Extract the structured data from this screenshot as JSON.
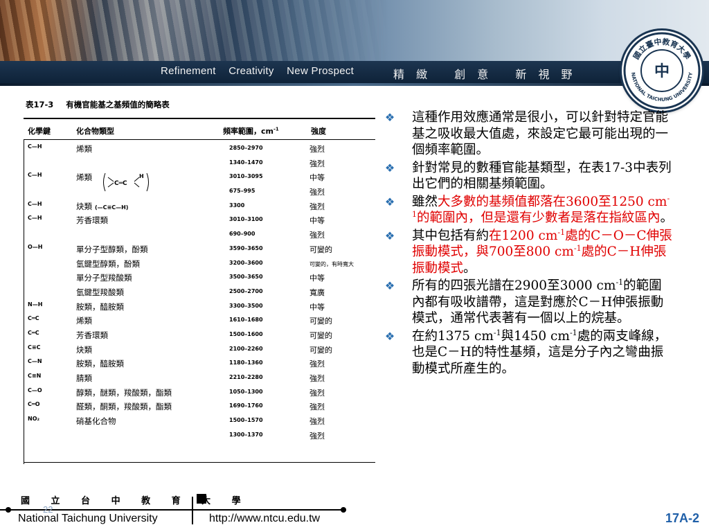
{
  "header": {
    "slogan_en": [
      "Refinement",
      "Creativity",
      "New Prospect"
    ],
    "slogan_cn": [
      "精 緻",
      "創 意",
      "新 視 野"
    ],
    "seal": {
      "top_text": "國立臺中教育大學",
      "bottom_text": "NATIONAL TAICHUNG UNIVERSITY",
      "center": "中"
    }
  },
  "table": {
    "caption_number": "表17-3",
    "caption_title": "有機官能基之基頻值的簡略表",
    "headers": {
      "bond": "化學鍵",
      "compound": "化合物類型",
      "frequency": "頻率範圍，cm",
      "frequency_sup": "-1",
      "intensity": "強度"
    },
    "rows": [
      {
        "bond": "C—H",
        "type": "烯類",
        "extra": "",
        "freq": "2850–2970",
        "intensity": "強烈"
      },
      {
        "bond": "",
        "type": "",
        "extra": "",
        "freq": "1340–1470",
        "intensity": "強烈"
      },
      {
        "bond": "C—H",
        "type": "烯類",
        "extra": "",
        "freq": "3010–3095",
        "intensity": "中等",
        "alkene": true
      },
      {
        "bond": "",
        "type": "",
        "extra": "",
        "freq": "675–995",
        "intensity": "強烈"
      },
      {
        "bond": "C—H",
        "type": "炔類",
        "extra": "(—C≡C—H)",
        "freq": "3300",
        "intensity": "強烈"
      },
      {
        "bond": "C—H",
        "type": "芳香環類",
        "extra": "",
        "freq": "3010–3100",
        "intensity": "中等"
      },
      {
        "bond": "",
        "type": "",
        "extra": "",
        "freq": "690–900",
        "intensity": "強烈"
      },
      {
        "bond": "O—H",
        "type": "單分子型醇類，酚類",
        "extra": "",
        "freq": "3590–3650",
        "intensity": "可變的"
      },
      {
        "bond": "",
        "type": "氫鍵型醇類，酚類",
        "extra": "",
        "freq": "3200–3600",
        "intensity": "可變的，有時寬大",
        "small": true
      },
      {
        "bond": "",
        "type": "單分子型羧酸類",
        "extra": "",
        "freq": "3500–3650",
        "intensity": "中等"
      },
      {
        "bond": "",
        "type": "氫鍵型羧酸類",
        "extra": "",
        "freq": "2500–2700",
        "intensity": "寬廣"
      },
      {
        "bond": "N—H",
        "type": "胺類，醯胺類",
        "extra": "",
        "freq": "3300–3500",
        "intensity": "中等"
      },
      {
        "bond": "C═C",
        "type": "烯類",
        "extra": "",
        "freq": "1610–1680",
        "intensity": "可變的"
      },
      {
        "bond": "C═C",
        "type": "芳香環類",
        "extra": "",
        "freq": "1500–1600",
        "intensity": "可變的"
      },
      {
        "bond": "C≡C",
        "type": "炔類",
        "extra": "",
        "freq": "2100–2260",
        "intensity": "可變的"
      },
      {
        "bond": "C—N",
        "type": "胺類，醯胺類",
        "extra": "",
        "freq": "1180–1360",
        "intensity": "強烈"
      },
      {
        "bond": "C≡N",
        "type": "腈類",
        "extra": "",
        "freq": "2210–2280",
        "intensity": "強烈"
      },
      {
        "bond": "C—O",
        "type": "醇類，醚類，羧酸類，酯類",
        "extra": "",
        "freq": "1050–1300",
        "intensity": "強烈"
      },
      {
        "bond": "C═O",
        "type": "醛類，酮類，羧酸類，酯類",
        "extra": "",
        "freq": "1690–1760",
        "intensity": "強烈"
      },
      {
        "bond": "NO₂",
        "type": "硝基化合物",
        "extra": "",
        "freq": "1500–1570",
        "intensity": "強烈"
      },
      {
        "bond": "",
        "type": "",
        "extra": "",
        "freq": "1300–1370",
        "intensity": "強烈"
      }
    ]
  },
  "bullets": [
    {
      "segments": [
        {
          "t": "這種作用效應通常是很小，可以針對特定官能基之吸收最大值處，來設定它最可能出現的一個頻率範圍。"
        }
      ]
    },
    {
      "segments": [
        {
          "t": "針對常見的數種官能基類型，在表17-3中表列出它們的相關基頻範圍。"
        }
      ]
    },
    {
      "segments": [
        {
          "t": "雖然"
        },
        {
          "t": "大多數的基頻值都落在3600至1250 cm",
          "red": true
        },
        {
          "t": "-1",
          "red": true,
          "sup": true
        },
        {
          "t": "的範圍內，但是還有少數者是落在指紋區內",
          "red": true
        },
        {
          "t": "。"
        }
      ]
    },
    {
      "segments": [
        {
          "t": "其中包括有約"
        },
        {
          "t": "在1200 cm",
          "red": true
        },
        {
          "t": "-1",
          "red": true,
          "sup": true
        },
        {
          "t": "處的C－O－C伸張振動模式，與700至800 cm",
          "red": true
        },
        {
          "t": "-1",
          "red": true,
          "sup": true
        },
        {
          "t": "處的C－H伸張振動模式",
          "red": true
        },
        {
          "t": "。"
        }
      ]
    },
    {
      "segments": [
        {
          "t": "所有的四張光譜在2900至3000 cm"
        },
        {
          "t": "-1",
          "sup": true
        },
        {
          "t": "的範圍內都有吸收譜帶，這是對應於C－H伸張振動模式，通常代表著有一個以上的烷基。"
        }
      ]
    },
    {
      "segments": [
        {
          "t": "在約1375 cm"
        },
        {
          "t": "-1",
          "sup": true
        },
        {
          "t": "與1450 cm"
        },
        {
          "t": "-1",
          "sup": true
        },
        {
          "t": "處的兩支峰線，也是C－H的特性基頻，這是分子內之彎曲振動模式所產生的。"
        }
      ]
    }
  ],
  "footer": {
    "university_cn": "國 立 台 中 教 育 大 學",
    "university_en": "National Taichung University",
    "url": "http://www.ntcu.edu.tw",
    "page_number": "22",
    "slide_code": "17A-2"
  },
  "colors": {
    "accent_red": "#e00000",
    "bullet_blue": "#2a6fb0",
    "slide_code_blue": "#1f5fa8",
    "nav_bar": "#1d3550"
  },
  "icons": {
    "bullet": "diamond-cluster-icon"
  }
}
